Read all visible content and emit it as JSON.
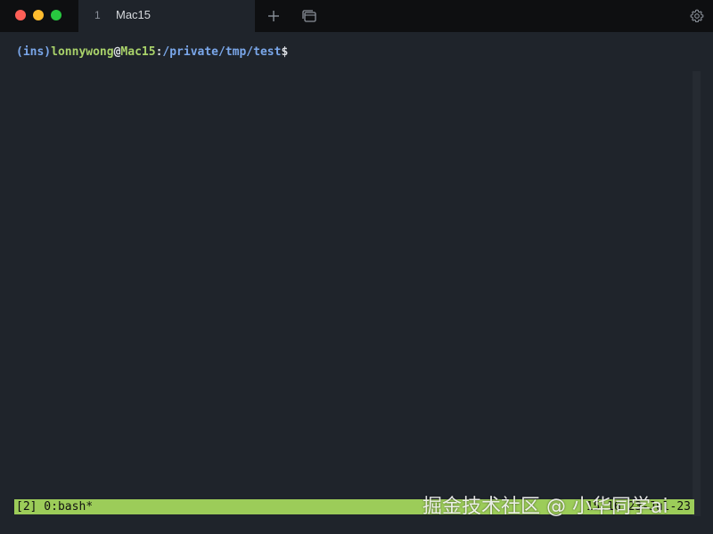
{
  "window": {
    "tab": {
      "index": "1",
      "title": "Mac15"
    },
    "icons": {
      "close": "close-traffic-light-icon",
      "minimize": "minimize-traffic-light-icon",
      "maximize": "maximize-traffic-light-icon",
      "new_tab": "plus-icon",
      "tab_overview": "window-stack-icon",
      "settings": "gear-icon"
    }
  },
  "terminal": {
    "prompt": {
      "env": "(ins)",
      "user": "lonnywong",
      "at": "@",
      "host": "Mac15",
      "separator": ":",
      "path": "/private/tmp/test",
      "symbol": "$"
    }
  },
  "statusbar": {
    "left": "[2] 0:bash*",
    "right": "15:16 23-Jul-23"
  },
  "watermark": {
    "text": "掘金技术社区 @ 小华同学ai"
  },
  "colors": {
    "background": "#1f242b",
    "titlebar": "#0e0f11",
    "status_green": "#9ccc59",
    "prompt_blue": "#7aa7ea",
    "prompt_green": "#a9d26a"
  }
}
